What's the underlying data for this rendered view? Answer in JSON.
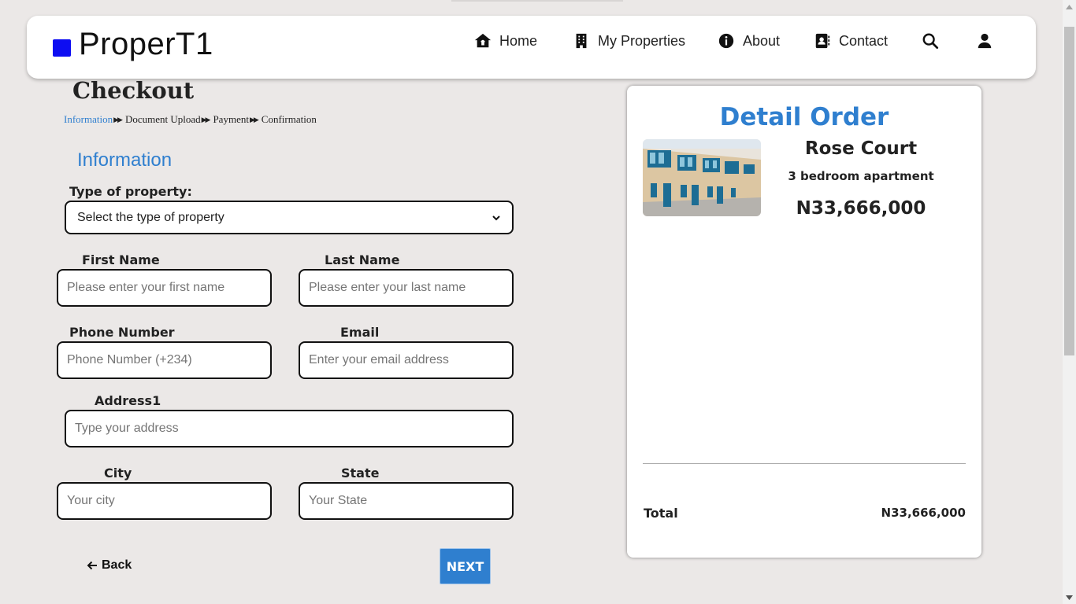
{
  "app": {
    "logo_text": "ProperT1",
    "brand_color": "#0d0df2",
    "accent_color": "#2f7fcf"
  },
  "nav": {
    "items": [
      {
        "label": "Home",
        "icon": "house-icon"
      },
      {
        "label": "My Properties",
        "icon": "building-icon"
      },
      {
        "label": "About",
        "icon": "info-circle-icon"
      },
      {
        "label": "Contact",
        "icon": "address-book-icon"
      }
    ],
    "search_icon": "search-icon",
    "user_icon": "user-icon"
  },
  "checkout": {
    "title": "Checkout",
    "breadcrumb": [
      "Information",
      "Document Upload",
      "Payment",
      "Confirmation"
    ],
    "active_step": "Information",
    "section_title": "Information"
  },
  "form": {
    "property_type": {
      "label": "Type of property:",
      "selected": "Select the type of property"
    },
    "first_name": {
      "label": "First Name",
      "placeholder": "Please enter your first name",
      "value": ""
    },
    "last_name": {
      "label": "Last Name",
      "placeholder": "Please enter your last name",
      "value": ""
    },
    "phone": {
      "label": "Phone Number",
      "placeholder": "Phone Number (+234)",
      "value": ""
    },
    "email": {
      "label": "Email",
      "placeholder": "Enter your email address",
      "value": ""
    },
    "address1": {
      "label": "Address1",
      "placeholder": "Type your address",
      "value": ""
    },
    "city": {
      "label": "City",
      "placeholder": "Your city",
      "value": ""
    },
    "state": {
      "label": "State",
      "placeholder": "Your State",
      "value": ""
    }
  },
  "actions": {
    "back_label": "Back",
    "next_label": "NEXT"
  },
  "order": {
    "title": "Detail Order",
    "property_name": "Rose Court",
    "property_type": "3 bedroom apartment",
    "price": "N33,666,000",
    "total_label": "Total",
    "total_value": "N33,666,000"
  }
}
